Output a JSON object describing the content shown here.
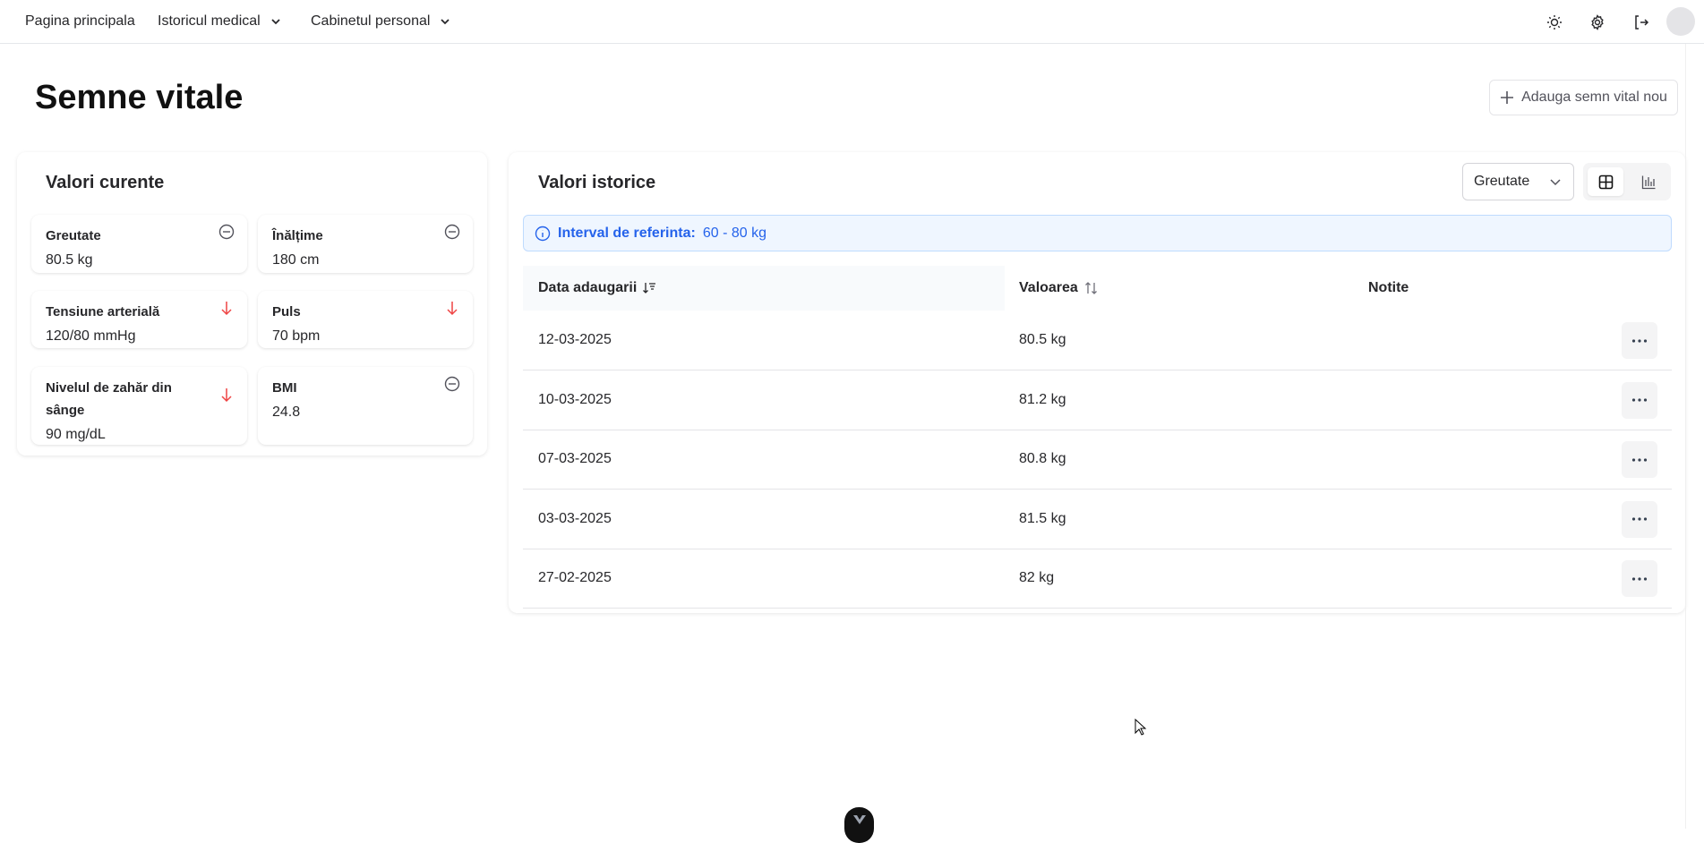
{
  "nav": {
    "items": [
      {
        "label": "Pagina principala"
      },
      {
        "label": "Istoricul medical"
      },
      {
        "label": "Cabinetul personal"
      }
    ],
    "icons": [
      "sun-icon",
      "gear-icon",
      "logout-icon"
    ]
  },
  "page": {
    "title": "Semne vitale",
    "add_button": "Adauga semn vital nou"
  },
  "current": {
    "title": "Valori curente",
    "items": [
      {
        "label": "Greutate",
        "value": "80.5 kg",
        "status": "neutral"
      },
      {
        "label": "Înălțime",
        "value": "180 cm",
        "status": "neutral"
      },
      {
        "label": "Tensiune arterială",
        "value": "120/80 mmHg",
        "status": "down"
      },
      {
        "label": "Puls",
        "value": "70 bpm",
        "status": "down"
      },
      {
        "label": "Nivelul de zahăr din sânge",
        "value": "90 mg/dL",
        "status": "down"
      },
      {
        "label": "BMI",
        "value": "24.8",
        "status": "neutral"
      }
    ]
  },
  "history": {
    "title": "Valori istorice",
    "select_value": "Greutate",
    "reference_label": "Interval de referinta:",
    "reference_value": "60 - 80 kg",
    "columns": [
      "Data adaugarii",
      "Valoarea",
      "Notite"
    ],
    "rows": [
      {
        "date": "12-03-2025",
        "value": "80.5 kg",
        "notes": ""
      },
      {
        "date": "10-03-2025",
        "value": "81.2 kg",
        "notes": ""
      },
      {
        "date": "07-03-2025",
        "value": "80.8 kg",
        "notes": ""
      },
      {
        "date": "03-03-2025",
        "value": "81.5 kg",
        "notes": ""
      },
      {
        "date": "27-02-2025",
        "value": "82 kg",
        "notes": ""
      }
    ]
  },
  "colors": {
    "down": "#ef4444",
    "accent": "#2563eb"
  }
}
